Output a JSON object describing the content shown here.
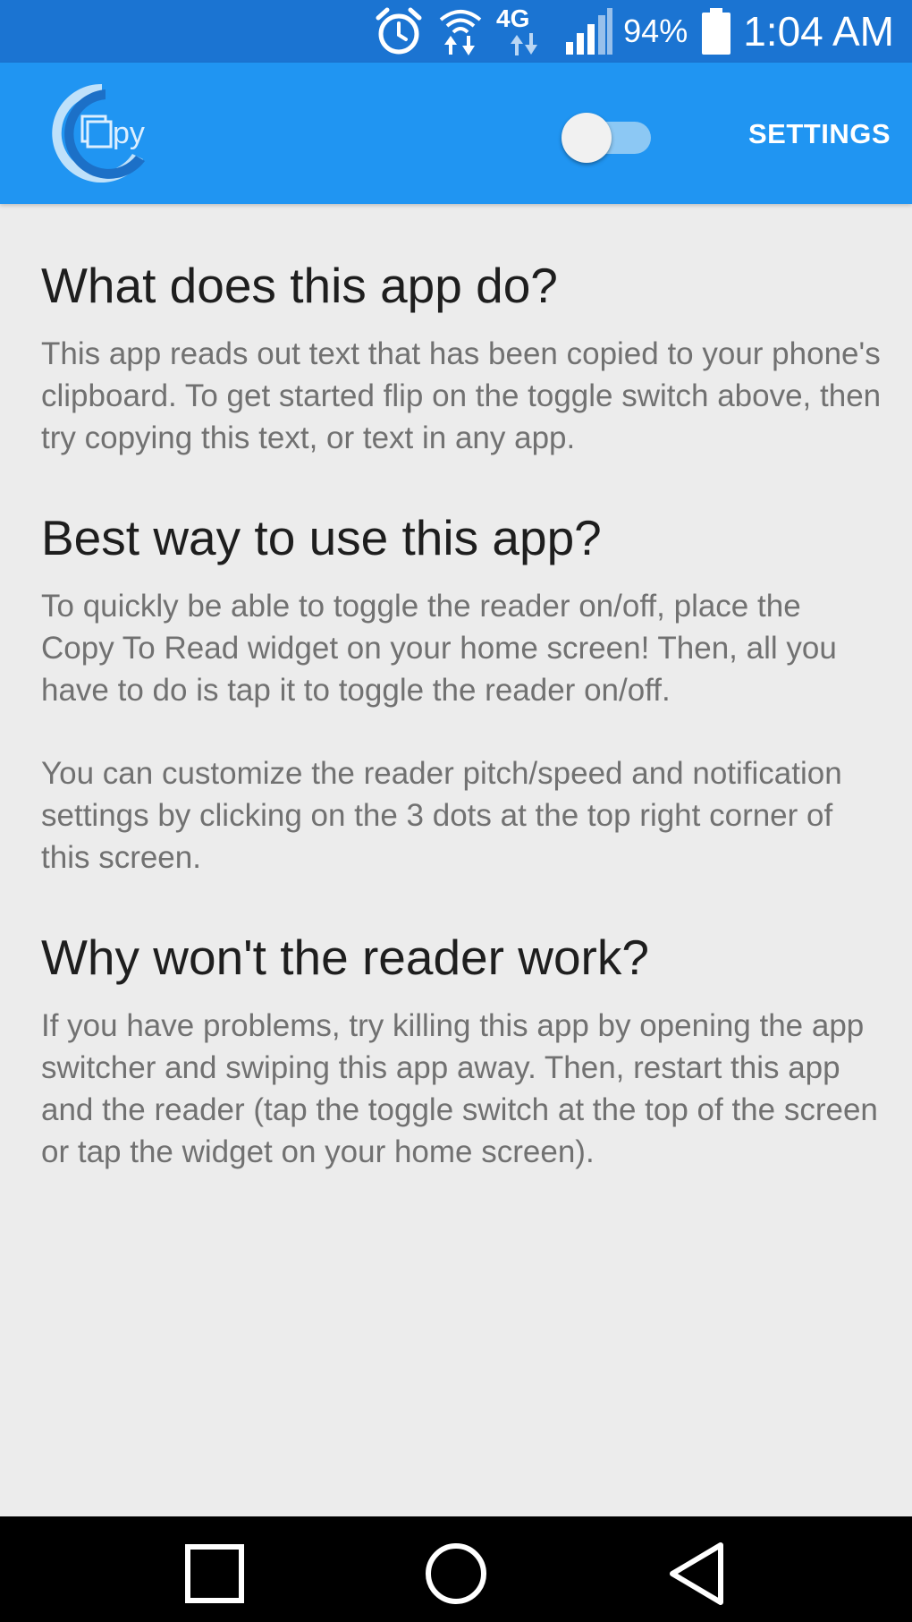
{
  "status_bar": {
    "network": "4G",
    "battery": "94%",
    "time": "1:04 AM",
    "icons": [
      "alarm-icon",
      "wifi-icon",
      "4g-data-icon",
      "signal-icon",
      "battery-icon"
    ]
  },
  "app_bar": {
    "logo_text": "Copy",
    "settings_label": "SETTINGS",
    "toggle_on": false,
    "colors": {
      "background": "#2095f2",
      "status_bar": "#1b74d2"
    }
  },
  "sections": [
    {
      "title": "What does this app do?",
      "paragraphs": [
        "This app reads out text that has been copied to your phone's clipboard. To get started flip on the toggle switch above, then try copying this text, or text in any app."
      ]
    },
    {
      "title": "Best way to use this app?",
      "paragraphs": [
        "To quickly be able to toggle the reader on/off, place the Copy To Read widget on your home screen! Then, all you have to do is tap it to toggle the reader on/off.",
        "You can customize the reader pitch/speed and notification settings by clicking on the 3 dots at the top right corner of this screen."
      ]
    },
    {
      "title": "Why won't the reader work?",
      "paragraphs": [
        "If you have problems, try killing this app by opening the app switcher and swiping this app away. Then, restart this app and the reader (tap the toggle switch at the top of the screen or tap the widget on your home screen)."
      ]
    }
  ],
  "nav_bar": {
    "icons": [
      "recent-apps-icon",
      "home-icon",
      "back-icon"
    ]
  }
}
